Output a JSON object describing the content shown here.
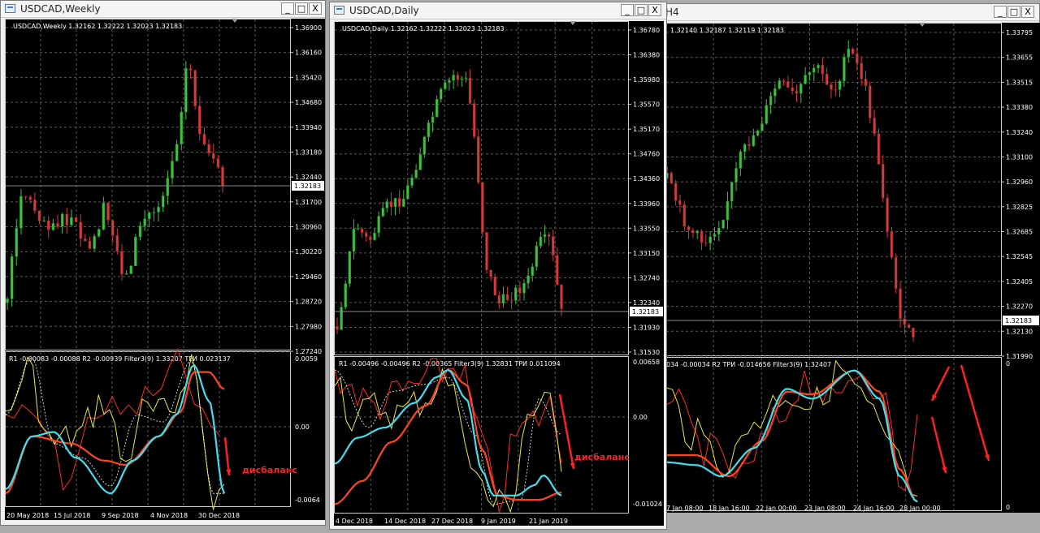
{
  "colors": {
    "bull": "#3cc43c",
    "bear": "#d43c3c",
    "grid": "#5a5a5a",
    "axis_text": "#ffffff",
    "red_line": "#ff4422",
    "cyan_line": "#44ddee",
    "yellow_line": "#e8e840",
    "thin_red": "#ff2a2a",
    "annotation": "#ff2020"
  },
  "windows": [
    {
      "title": "USDCAD,Weekly",
      "controls": {
        "minimize": "_",
        "maximize": "□",
        "close": "X"
      },
      "chart_label": "USDCAD,Weekly  1.32162 1.32222 1.32023 1.32183",
      "price_labels": [
        "1.36900",
        "1.36160",
        "1.35420",
        "1.34680",
        "1.33940",
        "1.33180",
        "1.32440",
        "1.31700",
        "1.30960",
        "1.30220",
        "1.29460",
        "1.28720",
        "1.27980",
        "1.27240"
      ],
      "current_price": "1.32183",
      "indicator_label": "R1 -0.00083 -0.00088  R2 -0.00939  Filter3(9) 1.33207  TPИ 0.023137",
      "indicator_scale": [
        "0.0059",
        "0.00",
        "-0.0064"
      ],
      "dates": [
        "20 May 2018",
        "15 Jul 2018",
        "9 Sep 2018",
        "4 Nov 2018",
        "30 Dec 2018"
      ],
      "annotation": "дисбаланс"
    },
    {
      "title": "USDCAD,Daily",
      "controls": {
        "minimize": "_",
        "maximize": "□",
        "close": "X"
      },
      "chart_label": "USDCAD,Daily  1.32162 1.32222 1.32023 1.32183",
      "price_labels": [
        "1.36780",
        "1.36380",
        "1.35980",
        "1.35570",
        "1.35170",
        "1.34760",
        "1.34360",
        "1.33960",
        "1.33550",
        "1.33150",
        "1.32740",
        "1.32340",
        "1.31930",
        "1.31530"
      ],
      "current_price": "1.32183",
      "indicator_label": "R1 -0.00496 -0.00496  R2 -0.00365  Filter3(9) 1.32831  TPИ 0.011094",
      "indicator_scale": [
        "0.00658",
        "0.00",
        "-0.01024"
      ],
      "dates": [
        "4 Dec 2018",
        "14 Dec 2018",
        "27 Dec 2018",
        "9 Jan 2019",
        "21 Jan 2019"
      ],
      "annotation": "дисбаланс"
    },
    {
      "title": "H4",
      "controls": {
        "minimize": "_",
        "maximize": "□",
        "close": "X"
      },
      "chart_label": "1.32140 1.32187 1.32119 1.32183",
      "price_labels": [
        "1.33795",
        "1.33655",
        "1.33515",
        "1.33380",
        "1.33240",
        "1.33100",
        "1.32960",
        "1.32825",
        "1.32685",
        "1.32545",
        "1.32405",
        "1.32270",
        "1.32130",
        "1.31990"
      ],
      "current_price": "1.32183",
      "indicator_label": "034 -0.00034  R2  TPИ -0.014656  Filter3(9) 1.32407",
      "indicator_scale": [
        "0",
        "0"
      ],
      "dates": [
        "7 Jan 08:00",
        "18 Jan 16:00",
        "22 Jan 00:00",
        "23 Jan 08:00",
        "24 Jan 16:00",
        "28 Jan 00:00"
      ],
      "annotation": ""
    }
  ]
}
